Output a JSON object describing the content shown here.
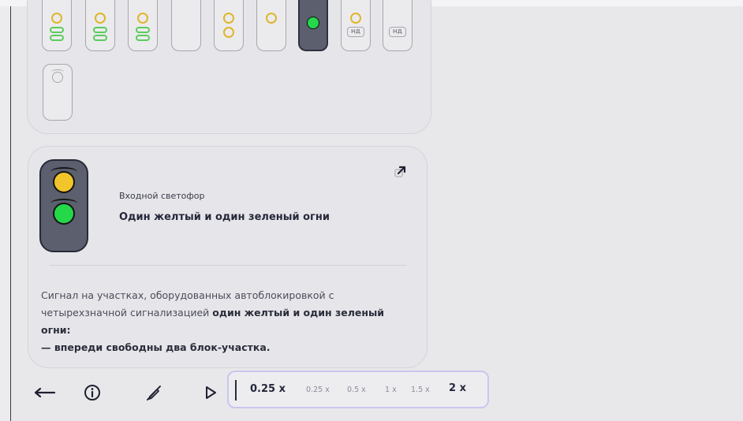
{
  "detail": {
    "subtitle": "Входной светофор",
    "title": "Один желтый и один зеленый огни",
    "description_part1": "Сигнал на участках, оборудованных автоблокировкой с четырехзначной сигнализацией ",
    "description_bold": "один желтый и один зеленый огни:",
    "description_part2": "— впереди свободны два блок-участка."
  },
  "grid": {
    "nd_label": "НД"
  },
  "toolbar": {
    "speed_current": "0.25 x",
    "speed_options": [
      "0.25 x",
      "0.5 x",
      "1 x",
      "1.5 x",
      "2 x"
    ]
  },
  "colors": {
    "yellow": "#f2c62a",
    "green": "#24d84a",
    "signal_body": "#5b5f6e",
    "speed_border": "#c9c6ee"
  },
  "icons": [
    "back-arrow-icon",
    "info-icon",
    "crossed-pen-icon",
    "play-icon",
    "external-link-icon"
  ]
}
